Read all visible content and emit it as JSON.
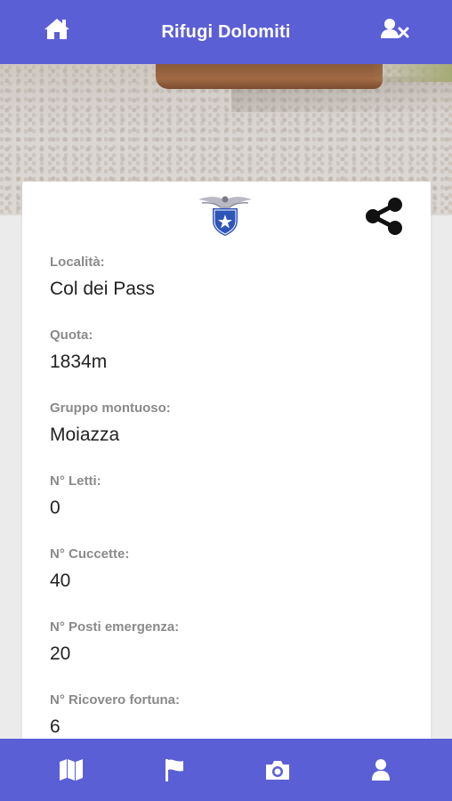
{
  "app": {
    "title": "Rifugi Dolomiti"
  },
  "colors": {
    "primary": "#5b5fd6",
    "background": "#ebebeb",
    "card": "#ffffff"
  },
  "header": {
    "left_icon": "home-icon",
    "right_icon": "user-remove-icon"
  },
  "card": {
    "logo_icon": "cai-eagle-logo",
    "share_icon": "share-icon",
    "fields": [
      {
        "label": "Località:",
        "value": "Col dei Pass"
      },
      {
        "label": "Quota:",
        "value": "1834m"
      },
      {
        "label": "Gruppo montuoso:",
        "value": "Moiazza"
      },
      {
        "label": "N° Letti:",
        "value": "0"
      },
      {
        "label": "N° Cuccette:",
        "value": "40"
      },
      {
        "label": "N° Posti emergenza:",
        "value": "20"
      },
      {
        "label": "N° Ricovero fortuna:",
        "value": "6"
      }
    ]
  },
  "bottom_nav": [
    {
      "icon": "map-icon"
    },
    {
      "icon": "flag-icon"
    },
    {
      "icon": "camera-icon"
    },
    {
      "icon": "user-icon"
    }
  ]
}
